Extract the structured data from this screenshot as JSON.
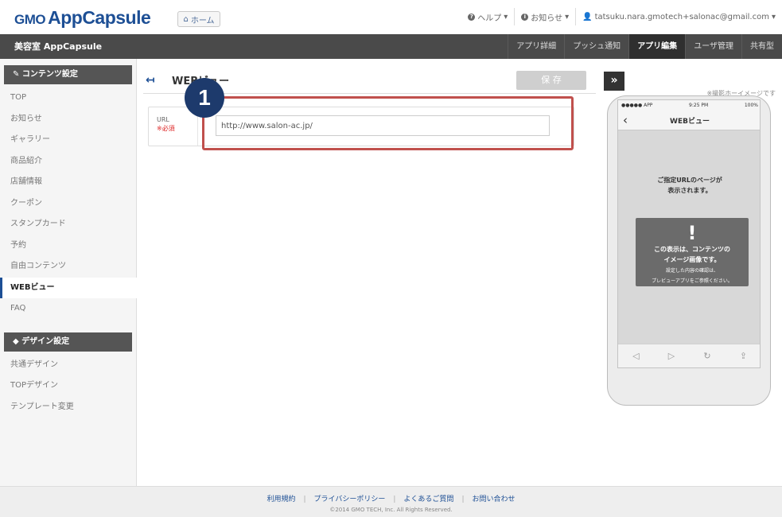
{
  "header": {
    "logo_gmo": "GMO",
    "logo_app": "AppCapsule",
    "home_button": "ホーム",
    "help": "ヘルプ",
    "news": "お知らせ",
    "user_email": "tatsuku.nara.gmotech+salonac@gmail.com"
  },
  "nav": {
    "brand": "美容室 AppCapsule",
    "tabs": [
      "アプリ詳細",
      "プッシュ通知",
      "アプリ編集",
      "ユーザ管理",
      "共有型"
    ]
  },
  "sidebar": {
    "content_header": "コンテンツ設定",
    "content_items": [
      "TOP",
      "お知らせ",
      "ギャラリー",
      "商品紹介",
      "店舗情報",
      "クーポン",
      "スタンプカード",
      "予約",
      "自由コンテンツ",
      "WEBビュー",
      "FAQ"
    ],
    "active_item": "WEBビュー",
    "design_header": "デザイン設定",
    "design_items": [
      "共通デザイン",
      "TOPデザイン",
      "テンプレート変更"
    ]
  },
  "main": {
    "title": "WEBビュー",
    "save_button": "保 存",
    "url_label": "URL",
    "url_required": "※必須",
    "url_value": "http://www.salon-ac.jp/"
  },
  "annotation": {
    "number": "1"
  },
  "preview": {
    "note": "※撮影ホーイメージです",
    "status_carrier": "●●●●● APP",
    "status_time": "9:25 PM",
    "status_battery": "100%",
    "phone_title": "WEBビュー",
    "message_line1": "ご指定URLのページが",
    "message_line2": "表示されます。",
    "warning_line1": "この表示は、コンテンツの",
    "warning_line2": "イメージ画像です。",
    "warning_line3": "設定した内容の確認は、",
    "warning_line4": "プレビューアプリをご参照ください。"
  },
  "footer": {
    "links": [
      "利用規約",
      "プライバシーポリシー",
      "よくあるご質問",
      "お問い合わせ"
    ],
    "copyright": "©2014 GMO TECH, Inc. All Rights Reserved."
  }
}
